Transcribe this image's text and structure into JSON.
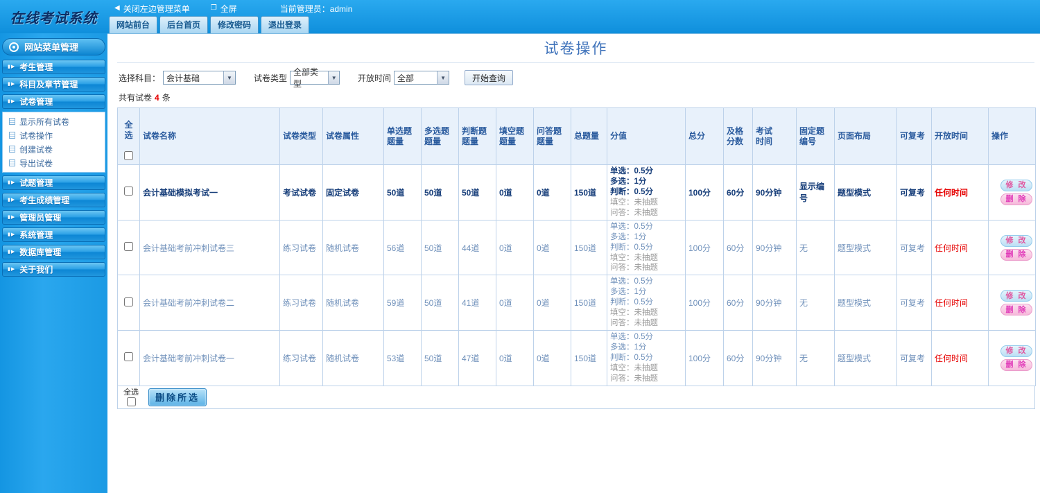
{
  "colors": {
    "brand_blue": "#189ee8",
    "title_blue": "#3e72ba",
    "alert_red": "#e60000",
    "edit_pink": "#e0559f",
    "delete_pink": "#e03ab8"
  },
  "icons": {
    "collapse_left": "◀",
    "fullscreen": "❐",
    "menu_item": "▮▶",
    "dropdown_arrow": "▼"
  },
  "header": {
    "logo": "在线考试系统",
    "menu_close": "关闭左边管理菜单",
    "menu_fullscreen": "全屏",
    "admin_label": "当前管理员：admin",
    "tabs": [
      "网站前台",
      "后台首页",
      "修改密码",
      "退出登录"
    ]
  },
  "sidebar": {
    "title": "网站菜单管理",
    "items": [
      "考生管理",
      "科目及章节管理",
      "试卷管理",
      "试题管理",
      "考生成绩管理",
      "管理员管理",
      "系统管理",
      "数据库管理",
      "关于我们"
    ],
    "submenu": [
      "显示所有试卷",
      "试卷操作",
      "创建试卷",
      "导出试卷"
    ]
  },
  "main": {
    "title": "试卷操作",
    "filters": {
      "subject_label": "选择科目：",
      "subject_value": "会计基础",
      "type_label": "试卷类型",
      "type_value": "全部类型",
      "time_label": "开放时间",
      "time_value": "全部",
      "search_button": "开始查询"
    },
    "count_prefix": "共有试卷",
    "count_value": "4",
    "count_suffix": "条",
    "table": {
      "headers": [
        "全选",
        "试卷名称",
        "试卷类型",
        "试卷属性",
        "单选题\n题量",
        "多选题\n题量",
        "判断题\n题量",
        "填空题\n题量",
        "问答题\n题量",
        "总题量",
        "分值",
        "总分",
        "及格\n分数",
        "考试\n时间",
        "固定题\n编号",
        "页面布局",
        "可复考",
        "开放时间",
        "操作"
      ],
      "ops": {
        "edit": "修 改",
        "delete": "删 除"
      },
      "rows": [
        {
          "name": "会计基础模拟考试一",
          "type": "考试试卷",
          "attr": "固定试卷",
          "single": "50道",
          "multi": "50道",
          "judge": "50道",
          "blank": "0道",
          "qa": "0道",
          "total": "150道",
          "score_main": "单选：0.5分\n多选：1分\n判断：0.5分",
          "score_muted": "填空：未抽题\n问答：未抽题",
          "total_score": "100分",
          "pass": "60分",
          "time": "90分钟",
          "fixed": "显示编号",
          "layout": "题型模式",
          "retake": "可复考",
          "open": "任何时间"
        },
        {
          "name": "会计基础考前冲刺试卷三",
          "type": "练习试卷",
          "attr": "随机试卷",
          "single": "56道",
          "multi": "50道",
          "judge": "44道",
          "blank": "0道",
          "qa": "0道",
          "total": "150道",
          "score_main": "单选：0.5分\n多选：1分\n判断：0.5分",
          "score_muted": "填空：未抽题\n问答：未抽题",
          "total_score": "100分",
          "pass": "60分",
          "time": "90分钟",
          "fixed": "无",
          "layout": "题型模式",
          "retake": "可复考",
          "open": "任何时间"
        },
        {
          "name": "会计基础考前冲刺试卷二",
          "type": "练习试卷",
          "attr": "随机试卷",
          "single": "59道",
          "multi": "50道",
          "judge": "41道",
          "blank": "0道",
          "qa": "0道",
          "total": "150道",
          "score_main": "单选：0.5分\n多选：1分\n判断：0.5分",
          "score_muted": "填空：未抽题\n问答：未抽题",
          "total_score": "100分",
          "pass": "60分",
          "time": "90分钟",
          "fixed": "无",
          "layout": "题型模式",
          "retake": "可复考",
          "open": "任何时间"
        },
        {
          "name": "会计基础考前冲刺试卷一",
          "type": "练习试卷",
          "attr": "随机试卷",
          "single": "53道",
          "multi": "50道",
          "judge": "47道",
          "blank": "0道",
          "qa": "0道",
          "total": "150道",
          "score_main": "单选：0.5分\n多选：1分\n判断：0.5分",
          "score_muted": "填空：未抽题\n问答：未抽题",
          "total_score": "100分",
          "pass": "60分",
          "time": "90分钟",
          "fixed": "无",
          "layout": "题型模式",
          "retake": "可复考",
          "open": "任何时间"
        }
      ]
    },
    "footer": {
      "select_all": "全选",
      "delete_selected": "删除所选"
    }
  }
}
